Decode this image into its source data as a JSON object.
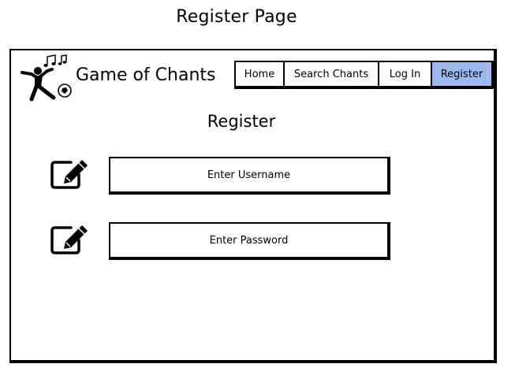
{
  "page": {
    "title": "Register Page"
  },
  "header": {
    "app_name": "Game of Chants"
  },
  "nav": {
    "items": [
      {
        "label": "Home",
        "active": false
      },
      {
        "label": "Search Chants",
        "active": false
      },
      {
        "label": "Log In",
        "active": false
      },
      {
        "label": "Register",
        "active": true
      }
    ],
    "active_color": "#9cb9f0"
  },
  "form": {
    "heading": "Register",
    "username_placeholder": "Enter Username",
    "password_placeholder": "Enter Password",
    "field_icon": "edit-icon"
  }
}
